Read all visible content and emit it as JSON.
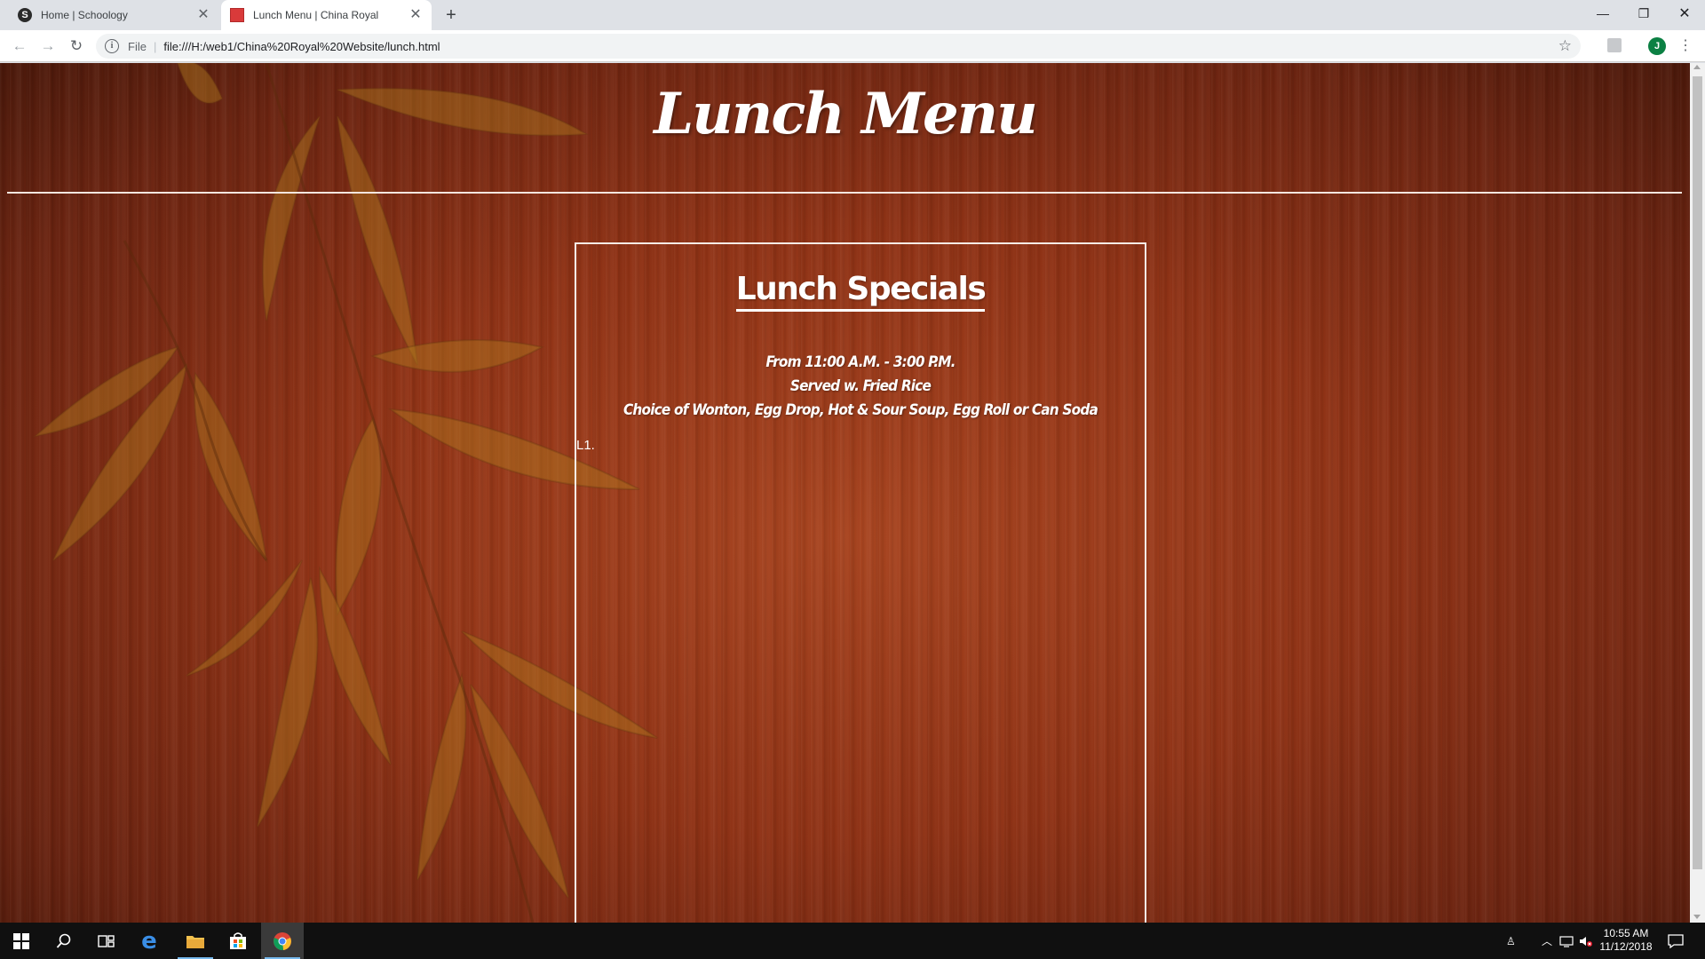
{
  "browser": {
    "tabs": [
      {
        "title": "Home | Schoology",
        "favicon": "schoology-icon",
        "favicon_letter": "S",
        "active": false
      },
      {
        "title": "Lunch Menu | China Royal",
        "favicon": "china-royal-icon",
        "active": true
      }
    ],
    "address_bar": {
      "scheme_label": "File",
      "url": "file:///H:/web1/China%20Royal%20Website/lunch.html"
    },
    "profile_initial": "J"
  },
  "page": {
    "title": "Lunch Menu",
    "section": {
      "heading": "Lunch Specials",
      "info_lines": [
        "From 11:00 A.M. - 3:00 P.M.",
        "Served w. Fried Rice",
        "Choice of Wonton, Egg Drop, Hot & Sour Soup, Egg Roll or Can Soda"
      ],
      "first_item_label": "L1."
    },
    "colors": {
      "text": "#ffffff",
      "wood": "#8f3215"
    }
  },
  "taskbar": {
    "time": "10:55 AM",
    "date": "11/12/2018"
  }
}
